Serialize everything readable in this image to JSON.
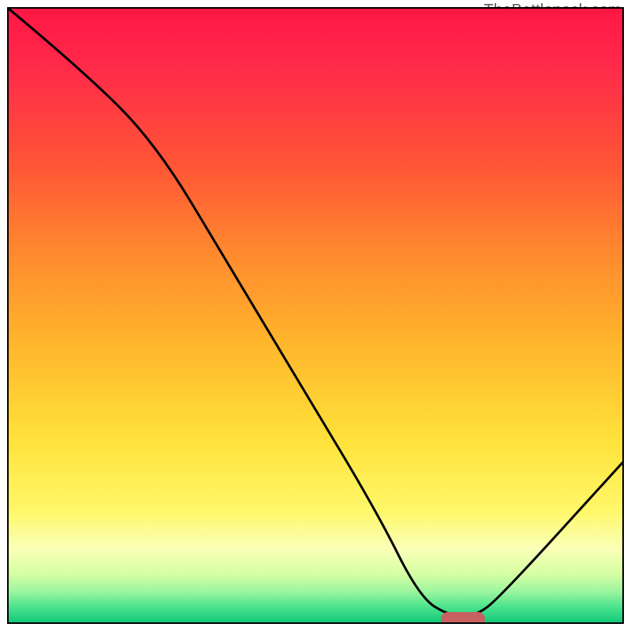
{
  "watermark": "TheBottleneck.com",
  "chart_data": {
    "type": "line",
    "title": "",
    "xlabel": "",
    "ylabel": "",
    "xlim": [
      0,
      100
    ],
    "ylim": [
      0,
      100
    ],
    "grid": false,
    "series": [
      {
        "name": "curve",
        "x": [
          0,
          12,
          24,
          36,
          48,
          60,
          67,
          72,
          76,
          80,
          100
        ],
        "values": [
          100,
          90,
          78,
          58,
          38,
          18,
          4,
          1,
          1,
          4,
          26
        ]
      }
    ],
    "marker": {
      "x": 74,
      "y": 0.5,
      "color": "#c96060"
    },
    "background_gradient": {
      "top": "#ff1744",
      "bottom": "#12c97a"
    }
  }
}
